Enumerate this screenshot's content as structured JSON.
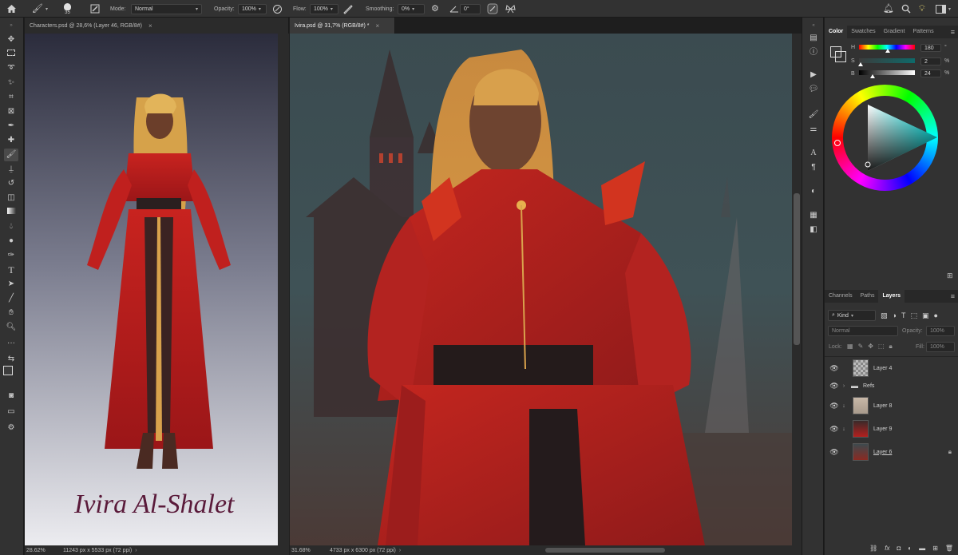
{
  "options_bar": {
    "brush_size": "35",
    "mode_label": "Mode:",
    "mode_value": "Normal",
    "opacity_label": "Opacity:",
    "opacity_value": "100%",
    "flow_label": "Flow:",
    "flow_value": "100%",
    "smoothing_label": "Smoothing:",
    "smoothing_value": "0%",
    "angle_value": "0°"
  },
  "documents": [
    {
      "tab": "Characters.psd @ 28,6% (Layer 46, RGB/8#)",
      "zoom": "28.62%",
      "size": "11243 px x 5533 px (72 ppi)",
      "signature": "Ivira Al-Shalet"
    },
    {
      "tab": "Ivira.psd @ 31,7% (RGB/8#) *",
      "zoom": "31.68%",
      "size": "4733 px x 6300 px (72 ppi)"
    }
  ],
  "color_panel": {
    "tabs": [
      "Color",
      "Swatches",
      "Gradient",
      "Patterns"
    ],
    "h_label": "H",
    "h_value": "180",
    "h_unit": "°",
    "s_label": "S",
    "s_value": "2",
    "s_unit": "%",
    "b_label": "B",
    "b_value": "24",
    "b_unit": "%"
  },
  "layers_panel": {
    "tabs": [
      "Channels",
      "Paths",
      "Layers"
    ],
    "filter_kind": "Kind",
    "blend_mode": "Normal",
    "opacity_label": "Opacity:",
    "opacity_value": "100%",
    "lock_label": "Lock:",
    "fill_label": "Fill:",
    "fill_value": "100%",
    "layers": [
      {
        "name": "Layer 4"
      },
      {
        "name": "Refs"
      },
      {
        "name": "Layer 8"
      },
      {
        "name": "Layer 9"
      },
      {
        "name": "Layer 6"
      }
    ]
  },
  "colors": {
    "accent": "#3a76d6",
    "dress_red": "#b3201e",
    "hair_gold": "#d9a24c"
  }
}
